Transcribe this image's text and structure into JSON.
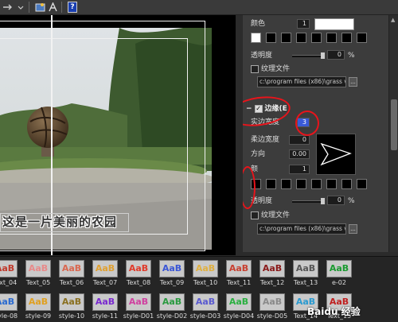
{
  "toolbar": {
    "items": [
      "arrow-right-icon",
      "chevron-down-icon",
      "image-icon",
      "text-style-icon",
      "help-icon"
    ],
    "help_glyph": "?"
  },
  "preview": {
    "caption": "这是一片美丽的农园"
  },
  "panel": {
    "color_label": "颜色",
    "color_value": "1",
    "transparency_label": "透明度",
    "transparency_value": "0",
    "percent": "%",
    "texture_label": "纹理文件",
    "texture_path": "c:\\program files (x86)\\grass va",
    "browse": "...",
    "border_header": "边缘(E",
    "border_checked": "✓",
    "solid_width_label": "实边宽度",
    "solid_width_value": "3",
    "soft_width_label": "柔边宽度",
    "soft_width_value": "0",
    "direction_label": "方向",
    "direction_value": "0.00",
    "color2_label": "颜",
    "color2_value": "1",
    "transparency2_label": "透明度",
    "transparency2_value": "0",
    "texture2_label": "纹理文件",
    "texture2_path": "c:\\program files (x86)\\grass va",
    "collapse": "−"
  },
  "gallery": {
    "row1": [
      {
        "label": "Text_04",
        "color": "#c0392b"
      },
      {
        "label": "Text_05",
        "color": "#e88a8a"
      },
      {
        "label": "Text_06",
        "color": "#d9674f"
      },
      {
        "label": "Text_07",
        "color": "#e0a030"
      },
      {
        "label": "Text_08",
        "color": "#e03a2a"
      },
      {
        "label": "Text_09",
        "color": "#3a56d6"
      },
      {
        "label": "Text_10",
        "color": "#e0b040"
      },
      {
        "label": "Text_11",
        "color": "#c84030"
      },
      {
        "label": "Text_12",
        "color": "#8a1a1a"
      },
      {
        "label": "Text_13",
        "color": "#555555"
      },
      {
        "label": "e-02",
        "color": "#1a9a30"
      }
    ],
    "row2": [
      {
        "label": "style-08",
        "color": "#2a6ad0"
      },
      {
        "label": "style-09",
        "color": "#e0a020"
      },
      {
        "label": "style-10",
        "color": "#8a7020"
      },
      {
        "label": "style-11",
        "color": "#7a2ad0"
      },
      {
        "label": "style-D01",
        "color": "#d040a0"
      },
      {
        "label": "style-D02",
        "color": "#2a9a40"
      },
      {
        "label": "style-D03",
        "color": "#5a5ad0"
      },
      {
        "label": "style-D04",
        "color": "#2ab040"
      },
      {
        "label": "style-D05",
        "color": "#8a8a8a"
      },
      {
        "label": "Text_14",
        "color": "#2a9ad0"
      },
      {
        "label": "Text_15",
        "color": "#c02020"
      }
    ],
    "sample": "AaB"
  },
  "watermark": "Baidu 经验"
}
